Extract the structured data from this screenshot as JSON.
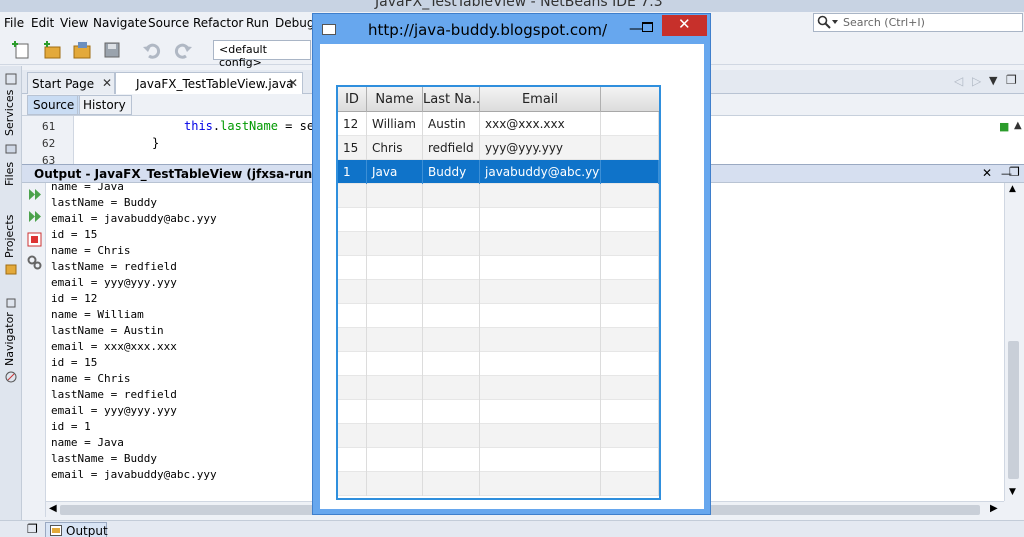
{
  "ide": {
    "window_title": "JavaFX_TestTableView - NetBeans IDE 7.3",
    "menu": [
      "File",
      "Edit",
      "View",
      "Navigate",
      "Source",
      "Refactor",
      "Run",
      "Debug"
    ],
    "search_placeholder": "Search (Ctrl+I)",
    "config": "<default config>",
    "sidebar": [
      "Services",
      "Files",
      "Projects",
      "Navigator"
    ],
    "editor_tabs": [
      {
        "label": "Start Page"
      },
      {
        "label": "JavaFX_TestTableView.java"
      }
    ],
    "source_tabs": [
      "Source",
      "History"
    ],
    "code_lines": [
      {
        "num": "61",
        "keyword": "this",
        "rest": ".",
        "field": "lastName",
        "tail": " = se"
      },
      {
        "num": "62",
        "keyword": "",
        "rest": "}",
        "field": "",
        "tail": ""
      },
      {
        "num": "63",
        "keyword": "",
        "rest": "",
        "field": "",
        "tail": ""
      }
    ],
    "output_title": "Output - JavaFX_TestTableView (jfxsa-run)",
    "output_lines": [
      "name = Java",
      "lastName = Buddy",
      "email = javabuddy@abc.yyy",
      "id = 15",
      "name = Chris",
      "lastName = redfield",
      "email = yyy@yyy.yyy",
      "id = 12",
      "name = William",
      "lastName = Austin",
      "email = xxx@xxx.xxx",
      "id = 15",
      "name = Chris",
      "lastName = redfield",
      "email = yyy@yyy.yyy",
      "id = 1",
      "name = Java",
      "lastName = Buddy",
      "email = javabuddy@abc.yyy"
    ],
    "status_tab": "Output"
  },
  "fx_window": {
    "title": "http://java-buddy.blogspot.com/",
    "columns": [
      "ID",
      "Name",
      "Last Na...",
      "Email"
    ],
    "rows": [
      {
        "id": "12",
        "name": "William",
        "last": "Austin",
        "email": "xxx@xxx.xxx"
      },
      {
        "id": "15",
        "name": "Chris",
        "last": "redfield",
        "email": "yyy@yyy.yyy"
      },
      {
        "id": "1",
        "name": "Java",
        "last": "Buddy",
        "email": "javabuddy@abc.yyy"
      }
    ],
    "selected_row": 2,
    "accent": "#0f73c9"
  }
}
